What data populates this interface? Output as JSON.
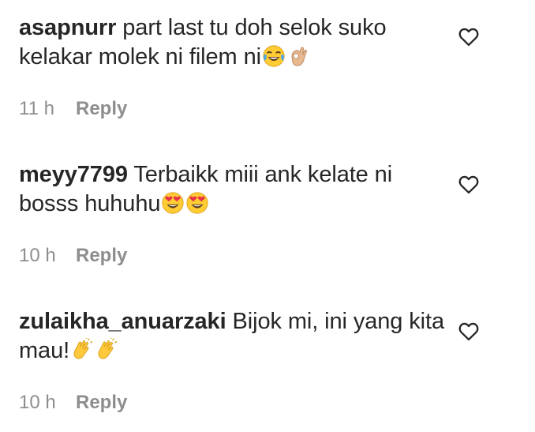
{
  "comments": [
    {
      "username": "asapnurr",
      "text": "part last tu doh selok suko kelakar molek ni filem ni",
      "emojis": [
        "joy-emoji",
        "ok-hand-emoji"
      ],
      "time": "11 h",
      "reply_label": "Reply"
    },
    {
      "username": "meyy7799",
      "text": "Terbaikk miii ank kelate ni bosss huhuhu",
      "emojis": [
        "heart-eyes-emoji",
        "heart-eyes-emoji"
      ],
      "time": "10 h",
      "reply_label": "Reply"
    },
    {
      "username": "zulaikha_anuarzaki",
      "text": "Bijok mi, ini yang kita mau!",
      "emojis": [
        "clapping-hands-emoji",
        "clapping-hands-emoji"
      ],
      "time": "10 h",
      "reply_label": "Reply"
    }
  ],
  "colors": {
    "text": "#262626",
    "secondary": "#8e8e8e",
    "background": "#ffffff"
  }
}
